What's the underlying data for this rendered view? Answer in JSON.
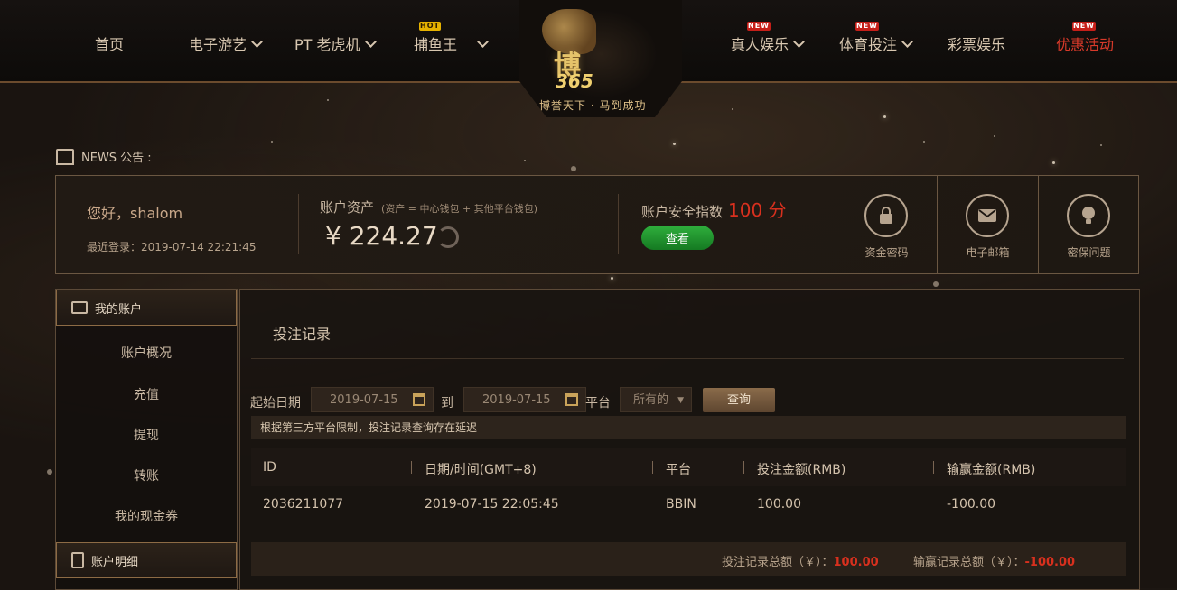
{
  "nav": {
    "items": [
      {
        "label": "首页"
      },
      {
        "label": "电子游艺"
      },
      {
        "label": "PT 老虎机"
      },
      {
        "label": "捕鱼王",
        "badge": "HOT"
      },
      {
        "label": "真人娱乐",
        "badge": "NEW"
      },
      {
        "label": "体育投注",
        "badge": "NEW"
      },
      {
        "label": "彩票娱乐"
      },
      {
        "label": "优惠活动",
        "badge": "NEW"
      }
    ]
  },
  "logo": {
    "main": "博",
    "num": "365",
    "slogan": "博誉天下 · 马到成功"
  },
  "news": {
    "label": "NEWS 公告 :"
  },
  "account": {
    "greeting": "您好，shalom",
    "last_login": "最近登录：2019-07-14 22:21:45",
    "assets_label": "账户资产",
    "assets_sub": "(资产 = 中心钱包 + 其他平台钱包)",
    "assets_value": "¥ 224.27",
    "safety_label": "账户安全指数",
    "safety_score": "100 分",
    "check_label": "查看"
  },
  "security": {
    "items": [
      {
        "label": "资金密码",
        "icon": "lock-icon"
      },
      {
        "label": "电子邮箱",
        "icon": "mail-icon"
      },
      {
        "label": "密保问题",
        "icon": "bulb-icon"
      }
    ]
  },
  "sidebar": {
    "head1": "我的账户",
    "items": [
      "账户概况",
      "充值",
      "提现",
      "转账",
      "我的现金券"
    ],
    "head2": "账户明细"
  },
  "main": {
    "title": "投注记录",
    "start_label": "起始日期",
    "start_date": "2019-07-15",
    "to_label": "到",
    "end_date": "2019-07-15",
    "platform_label": "平台",
    "platform_value": "所有的",
    "search_label": "查询",
    "notice": "根据第三方平台限制，投注记录查询存在延迟"
  },
  "table": {
    "headers": [
      "ID",
      "日期/时间(GMT+8)",
      "平台",
      "投注金额(RMB)",
      "输赢金额(RMB)"
    ],
    "rows": [
      {
        "id": "2036211077",
        "datetime": "2019-07-15 22:05:45",
        "platform": "BBIN",
        "bet": "100.00",
        "win": "-100.00"
      }
    ]
  },
  "summary": {
    "bet_label": "投注记录总额（￥）：",
    "bet_value": "100.00",
    "win_label": "输赢记录总额（￥）：",
    "win_value": "-100.00"
  },
  "colors": {
    "accent": "#d8301e",
    "gold": "#c9a35a",
    "green": "#1f9a2c"
  }
}
